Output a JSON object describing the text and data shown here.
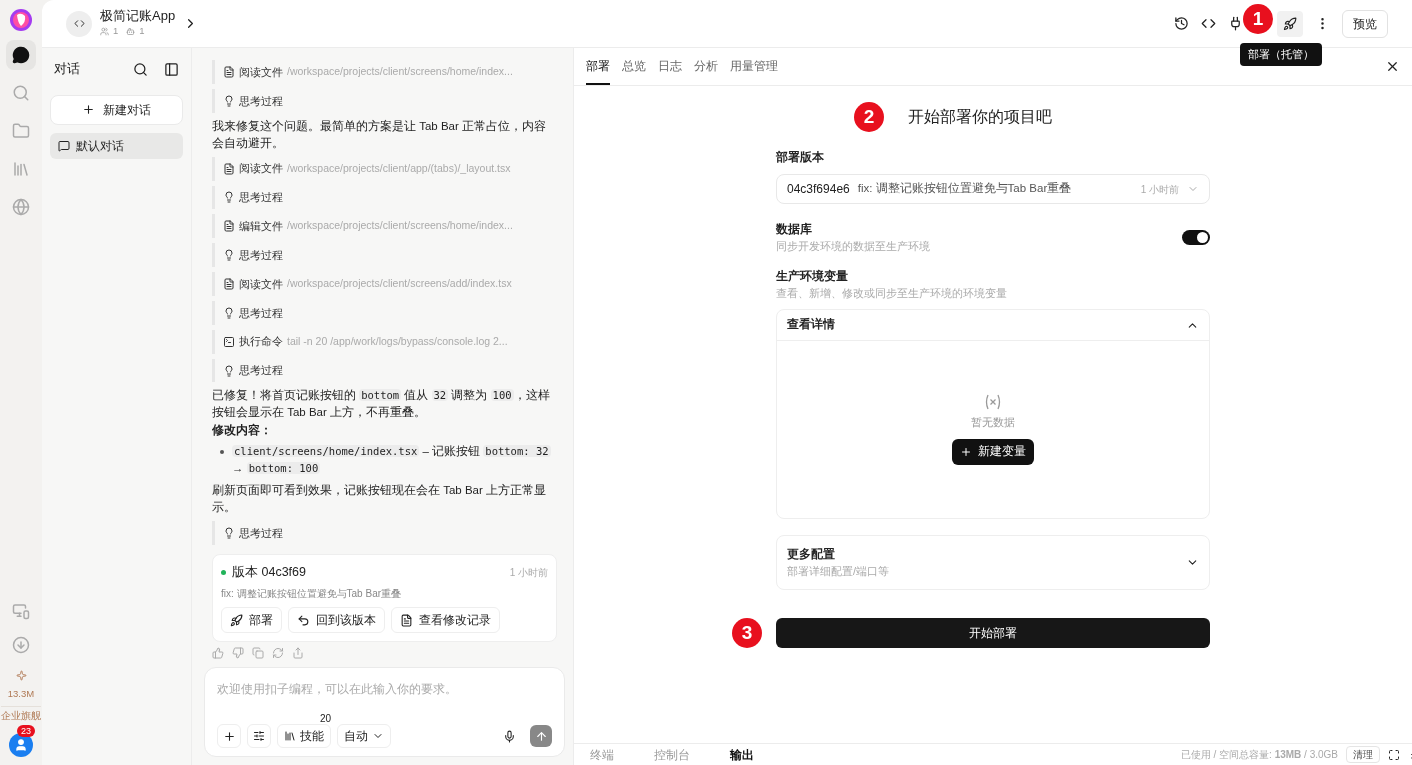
{
  "rail": {
    "items": [
      {
        "kind": "chat",
        "selected": true
      },
      {
        "kind": "search",
        "selected": false
      },
      {
        "kind": "folder",
        "selected": false
      },
      {
        "kind": "library",
        "selected": false
      },
      {
        "kind": "globe",
        "selected": false
      }
    ],
    "credits": "13.3M",
    "plan": "企业旗舰",
    "notifications": "23"
  },
  "header": {
    "project": "极简记账App",
    "members": "1",
    "bots": "1",
    "preview": "预览",
    "tooltip": "部署（托管）",
    "marker": "1"
  },
  "sidebar": {
    "title": "对话",
    "new_chat": "新建对话",
    "items": [
      {
        "label": "默认对话",
        "selected": true
      }
    ]
  },
  "chat": {
    "items": [
      {
        "kind": "file_tool",
        "action": "阅读文件",
        "detail": "/workspace/projects/client/screens/home/index..."
      },
      {
        "kind": "thought",
        "label": "思考过程"
      },
      {
        "kind": "message",
        "parts": [
          {
            "text": "我来修复这个问题。最简单的方案是让 Tab Bar 正常占位，内容会自动避开。",
            "code": false
          }
        ]
      },
      {
        "kind": "file_tool",
        "action": "阅读文件",
        "detail": "/workspace/projects/client/app/(tabs)/_layout.tsx"
      },
      {
        "kind": "thought",
        "label": "思考过程"
      },
      {
        "kind": "file_tool",
        "action": "编辑文件",
        "detail": "/workspace/projects/client/screens/home/index..."
      },
      {
        "kind": "thought",
        "label": "思考过程"
      },
      {
        "kind": "file_tool",
        "action": "阅读文件",
        "detail": "/workspace/projects/client/screens/add/index.tsx"
      },
      {
        "kind": "thought",
        "label": "思考过程"
      },
      {
        "kind": "command_tool",
        "action": "执行命令",
        "detail": "tail -n 20 /app/work/logs/bypass/console.log 2..."
      },
      {
        "kind": "thought",
        "label": "思考过程"
      },
      {
        "kind": "message",
        "parts": [
          {
            "text": "已修复！将首页记账按钮的 ",
            "code": false
          },
          {
            "text": "bottom",
            "code": true
          },
          {
            "text": " 值从 ",
            "code": false
          },
          {
            "text": "32",
            "code": true
          },
          {
            "text": " 调整为 ",
            "code": false
          },
          {
            "text": "100",
            "code": true
          },
          {
            "text": "，这样按钮会显示在 Tab Bar 上方，不再重叠。",
            "code": false
          }
        ]
      },
      {
        "kind": "heading",
        "text": "修改内容："
      },
      {
        "kind": "bullet",
        "parts": [
          {
            "text": "client/screens/home/index.tsx",
            "code": true
          },
          {
            "text": " – 记账按钮 ",
            "code": false
          },
          {
            "text": "bottom: 32",
            "code": true
          },
          {
            "text": " → ",
            "code": false
          },
          {
            "text": "bottom: 100",
            "code": true
          }
        ]
      },
      {
        "kind": "message",
        "parts": [
          {
            "text": "刷新页面即可看到效果，记账按钮现在会在 Tab Bar 上方正常显示。",
            "code": false
          }
        ]
      },
      {
        "kind": "thought",
        "label": "思考过程"
      }
    ],
    "version": {
      "title": "版本 04c3f69",
      "time": "1 小时前",
      "message": "fix: 调整记账按钮位置避免与Tab Bar重叠",
      "actions": [
        "部署",
        "回到该版本",
        "查看修改记录"
      ]
    },
    "input": {
      "placeholder": "欢迎使用扣子编程，可以在此输入你的要求。",
      "skills": "技能",
      "skills_count": "20",
      "mode": "自动"
    }
  },
  "panel": {
    "tabs": [
      {
        "label": "部署",
        "selected": true
      },
      {
        "label": "总览",
        "selected": false
      },
      {
        "label": "日志",
        "selected": false
      },
      {
        "label": "分析",
        "selected": false
      },
      {
        "label": "用量管理",
        "selected": false
      }
    ],
    "marker": "2",
    "title": "开始部署你的项目吧",
    "version_label": "部署版本",
    "version": {
      "hash": "04c3f694e6",
      "message": "fix: 调整记账按钮位置避免与Tab Bar重叠",
      "time": "1 小时前"
    },
    "database": {
      "label": "数据库",
      "hint": "同步开发环境的数据至生产环境",
      "on": true
    },
    "env": {
      "label": "生产环境变量",
      "hint": "查看、新增、修改或同步至生产环境的环境变量",
      "details": "查看详情",
      "expanded": true,
      "empty": "暂无数据",
      "add": "新建变量"
    },
    "more": {
      "label": "更多配置",
      "hint": "部署详细配置/端口等",
      "expanded": false
    },
    "deploy_marker": "3",
    "deploy": "开始部署"
  },
  "bottom_bar": {
    "tabs": [
      {
        "label": "终端",
        "selected": false
      },
      {
        "label": "控制台",
        "selected": false
      },
      {
        "label": "输出",
        "selected": true
      }
    ],
    "usage": "已使用 / 空间总容量: **13MB** / 3.0GB",
    "clear": "清理"
  }
}
